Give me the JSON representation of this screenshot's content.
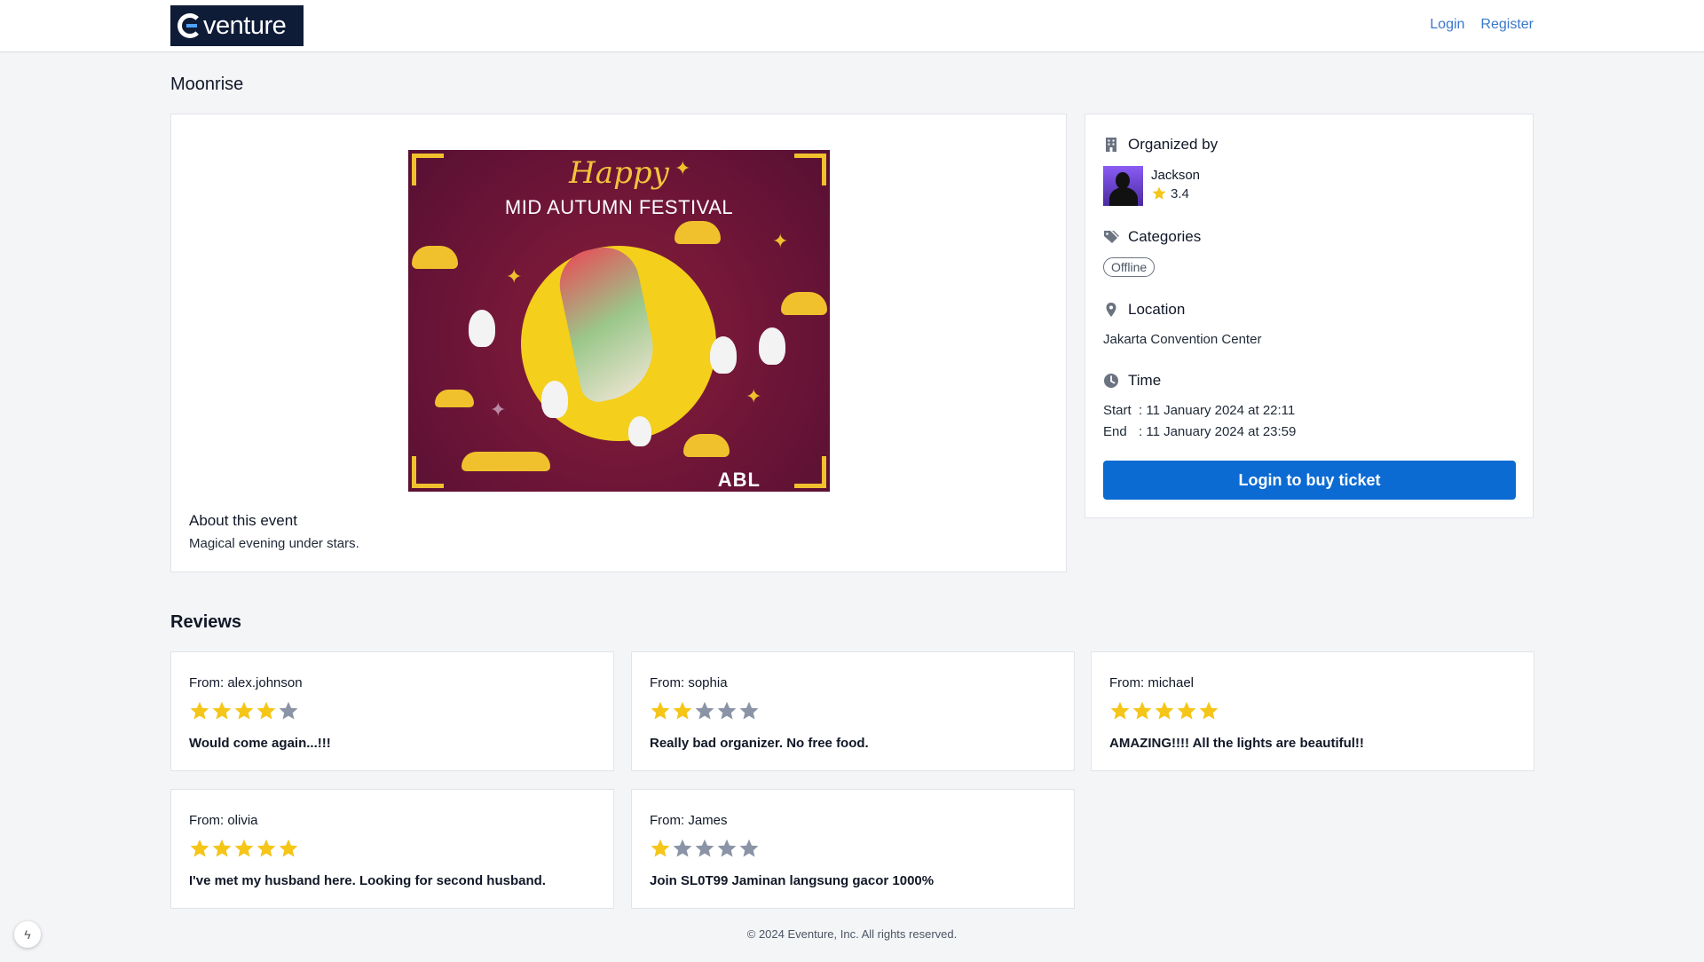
{
  "brand": {
    "logo_text": "venture"
  },
  "nav": {
    "login": "Login",
    "register": "Register"
  },
  "event": {
    "title": "Moonrise",
    "poster": {
      "happy": "Happy",
      "festival": "MID AUTUMN FESTIVAL",
      "brand": "ABL"
    },
    "about_heading": "About this event",
    "about_text": "Magical evening under stars."
  },
  "sidebar": {
    "organized_by": "Organized by",
    "organizer": {
      "name": "Jackson",
      "rating": "3.4"
    },
    "categories_title": "Categories",
    "categories": [
      "Offline"
    ],
    "location_title": "Location",
    "location": "Jakarta Convention Center",
    "time_title": "Time",
    "start_label": "Start",
    "start_value": ": 11 January 2024 at 22:11",
    "end_label": "End",
    "end_value": ": 11 January 2024 at 23:59",
    "buy_button": "Login to buy ticket"
  },
  "reviews": {
    "title": "Reviews",
    "items": [
      {
        "from": "From:  alex.johnson",
        "rating": 4,
        "text": "Would come again...!!!"
      },
      {
        "from": "From:  sophia",
        "rating": 2,
        "text": "Really bad organizer. No free food."
      },
      {
        "from": "From:  michael",
        "rating": 5,
        "text": "AMAZING!!!! All the lights are beautiful!!"
      },
      {
        "from": "From:  olivia",
        "rating": 5,
        "text": "I've met my husband here. Looking for second husband."
      },
      {
        "from": "From:  James",
        "rating": 1,
        "text": "Join SL0T99 Jaminan langsung gacor 1000%"
      }
    ]
  },
  "footer": {
    "copyright": "© 2024 Eventure, Inc. All rights reserved."
  },
  "colors": {
    "star_filled": "#f5c518",
    "star_empty": "#8a94a6",
    "primary": "#0b6bd3",
    "link": "#3a78c9"
  }
}
